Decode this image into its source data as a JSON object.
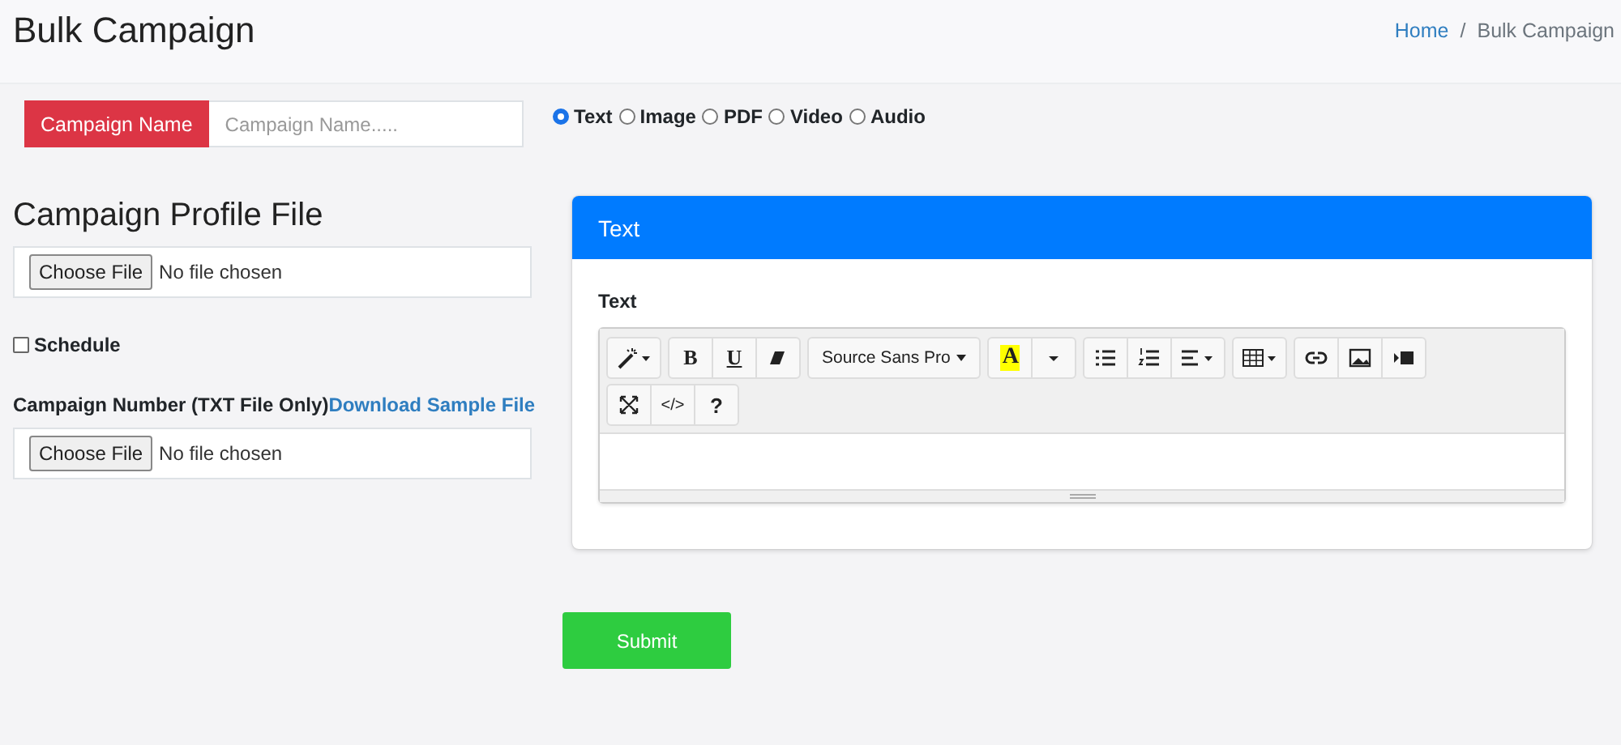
{
  "header": {
    "title": "Bulk Campaign",
    "separator": "/",
    "breadcrumb": [
      {
        "label": "Home",
        "kind": "link"
      },
      {
        "label": "Bulk Campaign",
        "kind": "current"
      }
    ]
  },
  "campaign_name": {
    "label": "Campaign Name",
    "placeholder": "Campaign Name....."
  },
  "message_types": [
    {
      "label": "Text",
      "selected": true
    },
    {
      "label": "Image",
      "selected": false
    },
    {
      "label": "PDF",
      "selected": false
    },
    {
      "label": "Video",
      "selected": false
    },
    {
      "label": "Audio",
      "selected": false
    }
  ],
  "profile_file": {
    "heading": "Campaign Profile File",
    "button": "Choose File",
    "status": "No file chosen"
  },
  "schedule": {
    "label": "Schedule",
    "checked": false
  },
  "number_file": {
    "label": "Campaign Number (TXT File Only)",
    "link": "Download Sample File",
    "button": "Choose File",
    "status": "No file chosen"
  },
  "card": {
    "title": "Text",
    "field_label": "Text",
    "toolbar": [
      [
        [
          {
            "kind": "magic"
          }
        ],
        [
          {
            "kind": "bold",
            "label": "B"
          },
          {
            "kind": "underline",
            "label": "U"
          },
          {
            "kind": "eraser"
          }
        ],
        [
          {
            "kind": "font",
            "label": "Source Sans Pro"
          }
        ],
        [
          {
            "kind": "color",
            "label": "A"
          },
          {
            "kind": "caret"
          }
        ],
        [
          {
            "kind": "ul"
          },
          {
            "kind": "ol"
          },
          {
            "kind": "align"
          }
        ],
        [
          {
            "kind": "table"
          }
        ],
        [
          {
            "kind": "link"
          },
          {
            "kind": "image"
          },
          {
            "kind": "video"
          }
        ]
      ],
      [
        [
          {
            "kind": "fullscreen"
          },
          {
            "kind": "code",
            "label": "</>"
          },
          {
            "kind": "help",
            "label": "?"
          }
        ]
      ]
    ]
  },
  "submit": "Submit"
}
